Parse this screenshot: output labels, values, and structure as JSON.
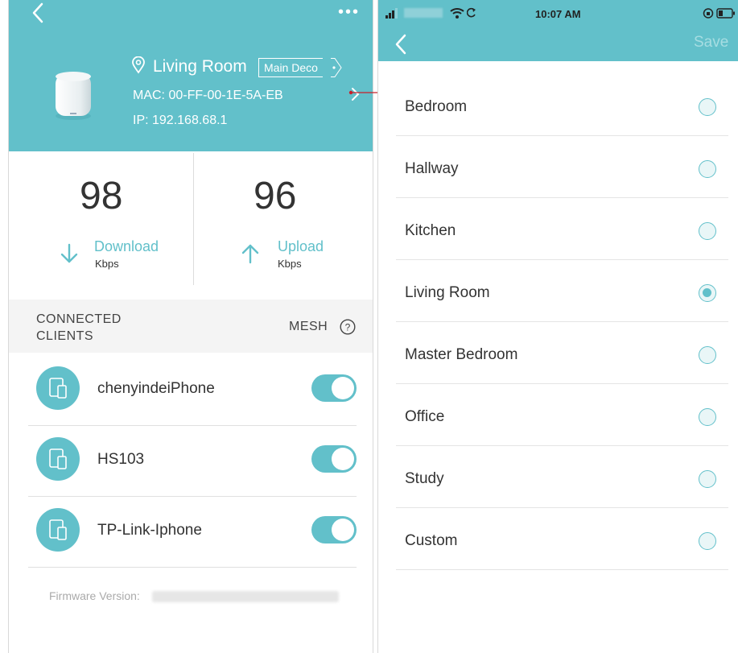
{
  "left": {
    "device": {
      "room_name": "Living Room",
      "badge": "Main Deco",
      "mac": "MAC: 00-FF-00-1E-5A-EB",
      "ip": "IP: 192.168.68.1"
    },
    "speed": {
      "download_value": "98",
      "download_label": "Download",
      "download_unit": "Kbps",
      "upload_value": "96",
      "upload_label": "Upload",
      "upload_unit": "Kbps"
    },
    "clients": {
      "title": "CONNECTED CLIENTS",
      "mesh_label": "MESH",
      "help_glyph": "?",
      "items": [
        {
          "name": "chenyindeiPhone",
          "on": true
        },
        {
          "name": "HS103",
          "on": true
        },
        {
          "name": "TP-Link-Iphone",
          "on": true
        }
      ]
    },
    "firmware_label": "Firmware Version:",
    "more_glyph": "•••"
  },
  "right": {
    "status": {
      "time": "10:07 AM"
    },
    "nav": {
      "save_label": "Save"
    },
    "rooms": [
      {
        "name": "Bedroom",
        "selected": false
      },
      {
        "name": "Hallway",
        "selected": false
      },
      {
        "name": "Kitchen",
        "selected": false
      },
      {
        "name": "Living Room",
        "selected": true
      },
      {
        "name": "Master Bedroom",
        "selected": false
      },
      {
        "name": "Office",
        "selected": false
      },
      {
        "name": "Study",
        "selected": false
      },
      {
        "name": "Custom",
        "selected": false
      }
    ]
  },
  "colors": {
    "accent": "#62c0ca",
    "link_arrow": "#c8202a"
  },
  "icons": [
    "back-chevron-icon",
    "more-icon",
    "location-pin-icon",
    "deco-device-icon",
    "chevron-right-icon",
    "download-arrow-icon",
    "upload-arrow-icon",
    "help-icon",
    "client-device-icon",
    "signal-icon",
    "wifi-icon",
    "lock-icon",
    "battery-icon"
  ]
}
